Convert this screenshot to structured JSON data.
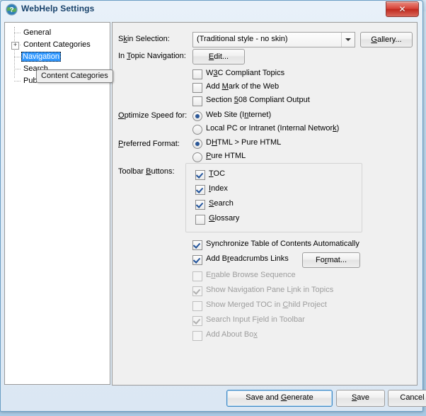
{
  "window": {
    "title": "WebHelp Settings",
    "app_icon": "globe-help-icon",
    "close_label": "✕",
    "close_icon": "close-icon"
  },
  "tree": {
    "items": [
      {
        "label": "General",
        "selected": false,
        "expandable": false
      },
      {
        "label": "Content Categories",
        "selected": false,
        "expandable": true,
        "expander": "+"
      },
      {
        "label": "Navigation",
        "selected": true,
        "expandable": false
      },
      {
        "label": "Search",
        "selected": false,
        "expandable": false
      },
      {
        "label": "Publish",
        "selected": false,
        "expandable": false
      }
    ]
  },
  "tooltip": {
    "text": "Content Categories"
  },
  "main": {
    "skin": {
      "label": "Skin Selection:",
      "label_pre": "S",
      "label_accel": "k",
      "label_post": "in Selection:",
      "value": "(Traditional style - no skin)",
      "gallery_pre": "",
      "gallery_accel": "G",
      "gallery_post": "allery..."
    },
    "in_topic": {
      "label_pre": "In ",
      "label_accel": "T",
      "label_post": "opic Navigation:",
      "edit_pre": "",
      "edit_accel": "E",
      "edit_post": "dit..."
    },
    "top_checks": [
      {
        "pre": "W",
        "accel": "3",
        "post": "C Compliant Topics",
        "checked": false,
        "disabled": false
      },
      {
        "pre": "Add ",
        "accel": "M",
        "post": "ark of the Web",
        "checked": false,
        "disabled": false
      },
      {
        "pre": "Section ",
        "accel": "5",
        "post": "08 Compliant Output",
        "checked": false,
        "disabled": false
      }
    ],
    "optimize": {
      "label_pre": "",
      "label_accel": "O",
      "label_post": "ptimize Speed for:",
      "options": [
        {
          "pre": "Web Site (I",
          "accel": "n",
          "post": "ternet)",
          "selected": true
        },
        {
          "pre": "Local PC or Intranet (Internal Networ",
          "accel": "k",
          "post": ")",
          "selected": false
        }
      ]
    },
    "format": {
      "label_pre": "",
      "label_accel": "P",
      "label_post": "referred Format:",
      "options": [
        {
          "pre": "D",
          "accel": "H",
          "post": "TML > Pure HTML",
          "selected": true
        },
        {
          "pre": "",
          "accel": "P",
          "post": "ure HTML",
          "selected": false
        }
      ]
    },
    "toolbar_buttons": {
      "label_pre": "Toolbar ",
      "label_accel": "B",
      "label_post": "uttons:",
      "items": [
        {
          "pre": "",
          "accel": "T",
          "post": "OC",
          "checked": true
        },
        {
          "pre": "",
          "accel": "I",
          "post": "ndex",
          "checked": true
        },
        {
          "pre": "",
          "accel": "S",
          "post": "earch",
          "checked": true
        },
        {
          "pre": "",
          "accel": "G",
          "post": "lossary",
          "checked": false
        }
      ]
    },
    "bottom_checks": [
      {
        "pre": "Synchronize Table of Contents Automatically",
        "accel": "",
        "post": "",
        "checked": true,
        "disabled": false
      },
      {
        "pre": "Add B",
        "accel": "r",
        "post": "eadcrumbs Links",
        "checked": true,
        "disabled": false
      },
      {
        "pre": "E",
        "accel": "n",
        "post": "able Browse Sequence",
        "checked": false,
        "disabled": true
      },
      {
        "pre": "Show Navigation Pane L",
        "accel": "i",
        "post": "nk in Topics",
        "checked": true,
        "disabled": true
      },
      {
        "pre": "Show Merged TOC in ",
        "accel": "C",
        "post": "hild Project",
        "checked": false,
        "disabled": true
      },
      {
        "pre": "Search Input F",
        "accel": "i",
        "post": "eld in Toolbar",
        "checked": true,
        "disabled": true
      },
      {
        "pre": "Add About Bo",
        "accel": "x",
        "post": "",
        "checked": false,
        "disabled": true
      }
    ],
    "format_button": {
      "pre": "Fo",
      "accel": "r",
      "post": "mat..."
    }
  },
  "footer": {
    "save_generate": {
      "pre": "Save and ",
      "accel": "G",
      "post": "enerate"
    },
    "save": {
      "pre": "",
      "accel": "S",
      "post": "ave"
    },
    "cancel": {
      "pre": "Cancel",
      "accel": "",
      "post": ""
    }
  },
  "colors": {
    "selection_blue": "#3399ff",
    "close_red": "#d8453a",
    "default_button_border": "#3c87c4",
    "radio_dot": "#2b5797",
    "check_mark": "#21539b",
    "disabled_text": "#9d9d9d"
  }
}
